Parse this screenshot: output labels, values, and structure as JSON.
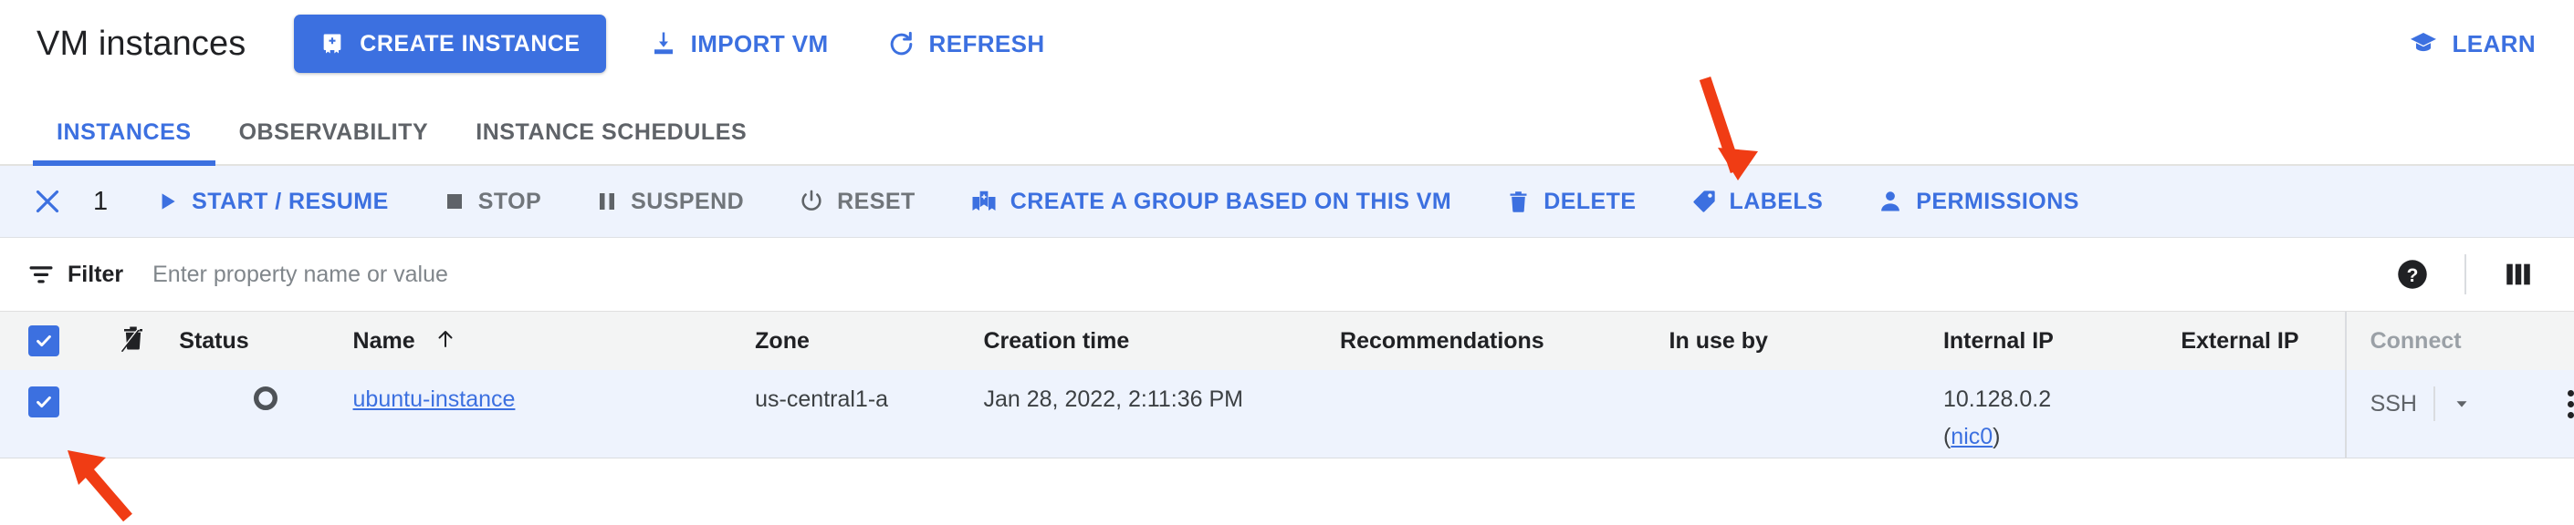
{
  "header": {
    "title": "VM instances",
    "create_button": "CREATE INSTANCE",
    "import_button": "IMPORT VM",
    "refresh_button": "REFRESH",
    "learn_button": "LEARN",
    "accent_color": "#3c70e0"
  },
  "tabs": [
    {
      "label": "INSTANCES",
      "active": true
    },
    {
      "label": "OBSERVABILITY",
      "active": false
    },
    {
      "label": "INSTANCE SCHEDULES",
      "active": false
    }
  ],
  "toolbar": {
    "close_label": "×",
    "selected_count": "1",
    "actions": [
      {
        "label": "START / RESUME",
        "icon": "play-icon",
        "enabled": true
      },
      {
        "label": "STOP",
        "icon": "stop-icon",
        "enabled": false
      },
      {
        "label": "SUSPEND",
        "icon": "pause-icon",
        "enabled": false
      },
      {
        "label": "RESET",
        "icon": "power-icon",
        "enabled": false
      },
      {
        "label": "CREATE A GROUP BASED ON THIS VM",
        "icon": "group-icon",
        "enabled": true
      },
      {
        "label": "DELETE",
        "icon": "trash-icon",
        "enabled": true
      },
      {
        "label": "LABELS",
        "icon": "label-icon",
        "enabled": true
      },
      {
        "label": "PERMISSIONS",
        "icon": "person-icon",
        "enabled": true
      }
    ]
  },
  "filter": {
    "label": "Filter",
    "placeholder": "Enter property name or value",
    "value": ""
  },
  "table": {
    "columns": [
      "Status",
      "Name",
      "Zone",
      "Creation time",
      "Recommendations",
      "In use by",
      "Internal IP",
      "External IP",
      "Connect"
    ],
    "sort_column": "Name",
    "sort_direction": "asc",
    "rows": [
      {
        "selected": true,
        "status": "stopped",
        "name": "ubuntu-instance",
        "zone": "us-central1-a",
        "creation_time": "Jan 28, 2022, 2:11:36 PM",
        "recommendations": "",
        "in_use_by": "",
        "internal_ip": "10.128.0.2",
        "internal_ip_nic": "nic0",
        "external_ip": "",
        "connect": "SSH"
      }
    ]
  },
  "annotations": {
    "arrow_color": "#f03c14",
    "delete_arrow": "points-to-delete-button",
    "checkbox_arrow": "points-to-row-checkbox"
  }
}
